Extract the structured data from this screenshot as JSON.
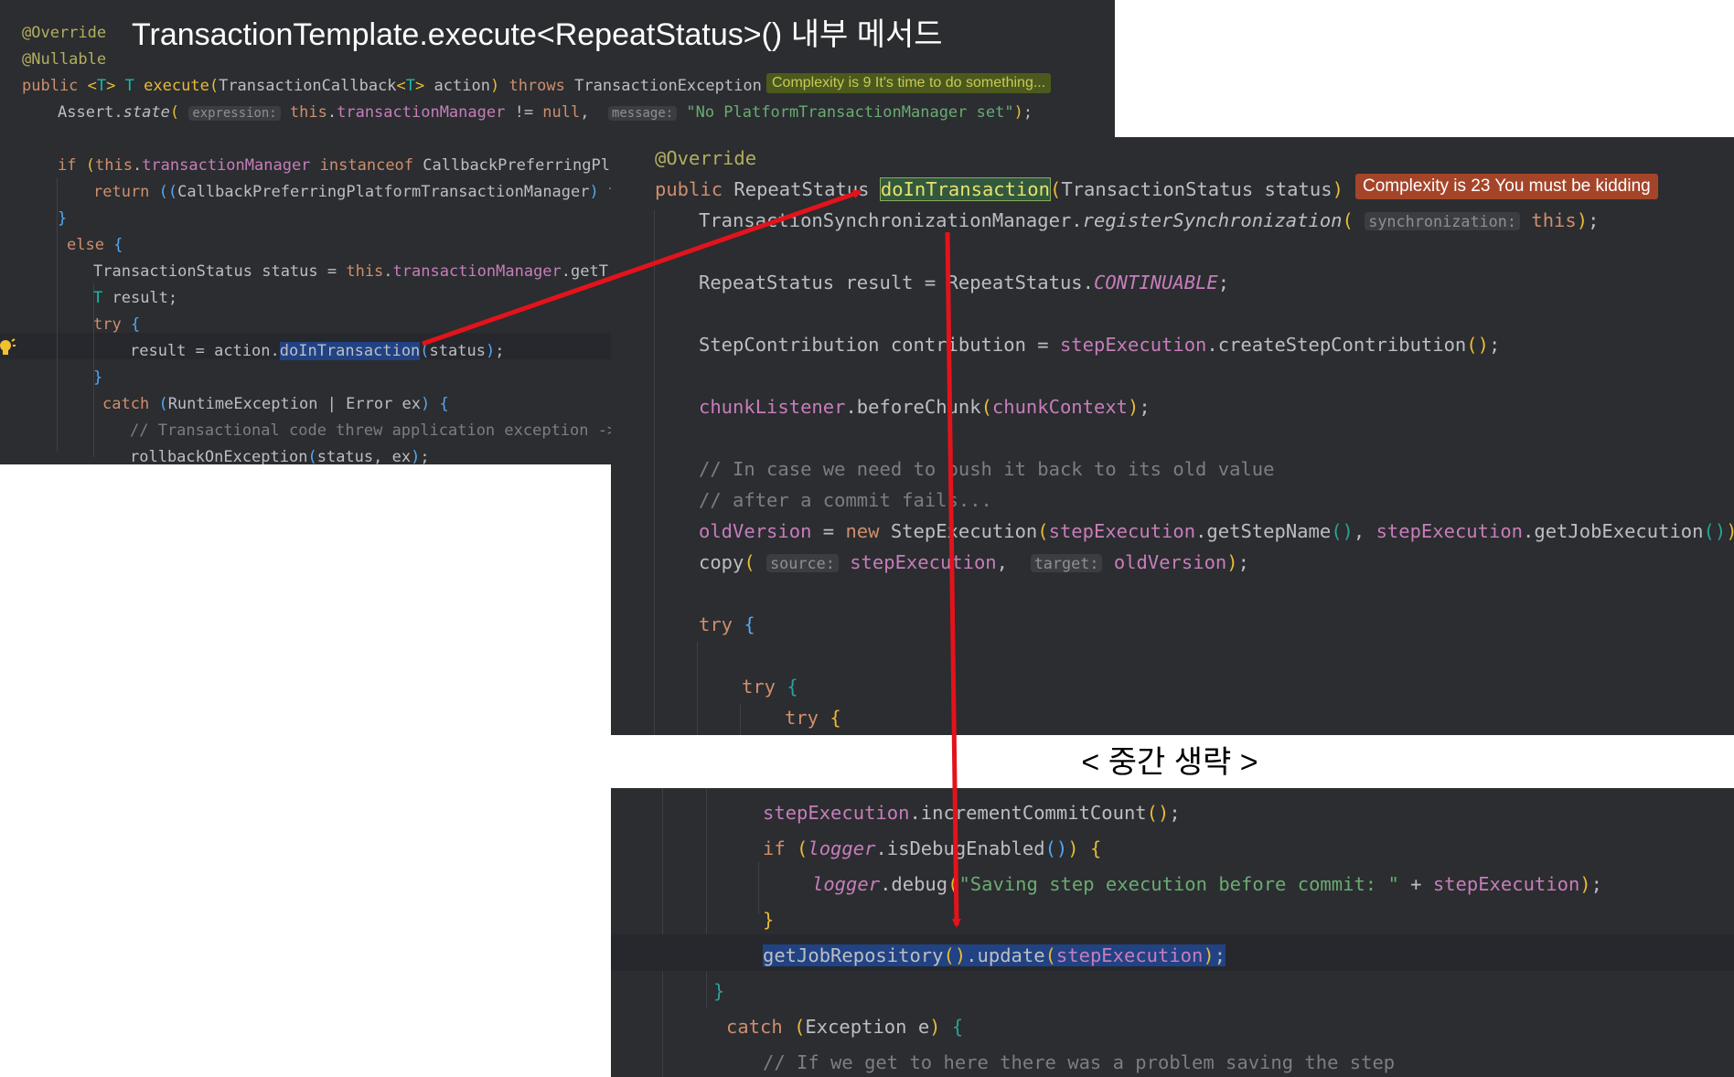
{
  "title": "TransactionTemplate.execute<RepeatStatus>() 내부 메서드",
  "omission_label": "< 중간 생략 >",
  "panel1": {
    "complexity_badge": "Complexity is 9 It's time to do something...",
    "lines": [
      "@Override",
      "@Nullable",
      "public <T> T execute(TransactionCallback<T> action) throws TransactionException {",
      "Assert.state( expression: this.transactionManager != null,  message: \"No PlatformTransactionManager set\");",
      "",
      "if (this.transactionManager instanceof CallbackPreferringPlat",
      "return ((CallbackPreferringPlatformTransactionManager) th",
      "}",
      "else {",
      "TransactionStatus status = this.transactionManager.getTra",
      "T result;",
      "try {",
      "result = action.doInTransaction(status);",
      "}",
      "catch (RuntimeException | Error ex) {",
      "// Transactional code threw application exception ->",
      "rollbackOnException(status, ex);"
    ]
  },
  "panel2": {
    "complexity_badge": "Complexity is 23 You must be kidding",
    "lines": [
      "@Override",
      "public RepeatStatus doInTransaction(TransactionStatus status) {",
      "TransactionSynchronizationManager.registerSynchronization( synchronization: this);",
      "",
      "RepeatStatus result = RepeatStatus.CONTINUABLE;",
      "",
      "StepContribution contribution = stepExecution.createStepContribution();",
      "",
      "chunkListener.beforeChunk(chunkContext);",
      "",
      "// In case we need to push it back to its old value",
      "// after a commit fails...",
      "oldVersion = new StepExecution(stepExecution.getStepName(), stepExecution.getJobExecution());",
      "copy( source: stepExecution,  target: oldVersion);",
      "",
      "try {",
      "",
      "try {",
      "try {"
    ]
  },
  "panel3": {
    "lines": [
      "stepExecution.incrementCommitCount();",
      "if (logger.isDebugEnabled()) {",
      "logger.debug(\"Saving step execution before commit: \" + stepExecution);",
      "}",
      "getJobRepository().update(stepExecution);",
      "}",
      "catch (Exception e) {",
      "// If we get to here there was a problem saving the step"
    ]
  },
  "colors": {
    "editor_bg": "#2b2d30",
    "arrow": "#e3131b",
    "badge_red": "#a4452a",
    "badge_green": "#4b5a1c"
  }
}
